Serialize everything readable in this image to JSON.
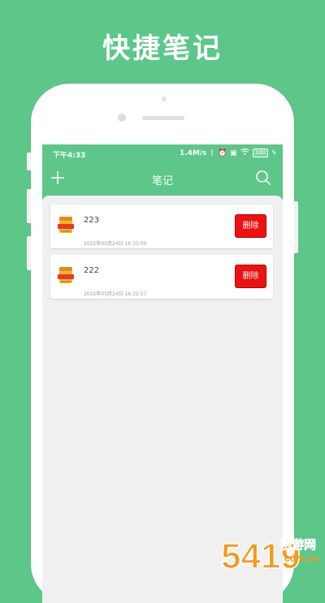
{
  "promo": {
    "headline": "快捷笔记"
  },
  "status_bar": {
    "time": "下午4:33",
    "speed": "1.4M/s",
    "battery": "100"
  },
  "app_bar": {
    "title": "笔记"
  },
  "icons": {
    "add": "plus-icon",
    "search": "search-icon",
    "note": "notebook-icon"
  },
  "notes": [
    {
      "title": "223",
      "date": "2022年03月24日 16:33:00",
      "delete_label": "删除"
    },
    {
      "title": "222",
      "date": "2022年03月24日 16:32:57",
      "delete_label": "删除"
    }
  ],
  "watermark": {
    "number": "5419",
    "text": "手游网",
    "domain": "com.cn"
  },
  "colors": {
    "accent": "#5dc78a",
    "delete": "#ee1111",
    "background": "#f0f0f0"
  }
}
